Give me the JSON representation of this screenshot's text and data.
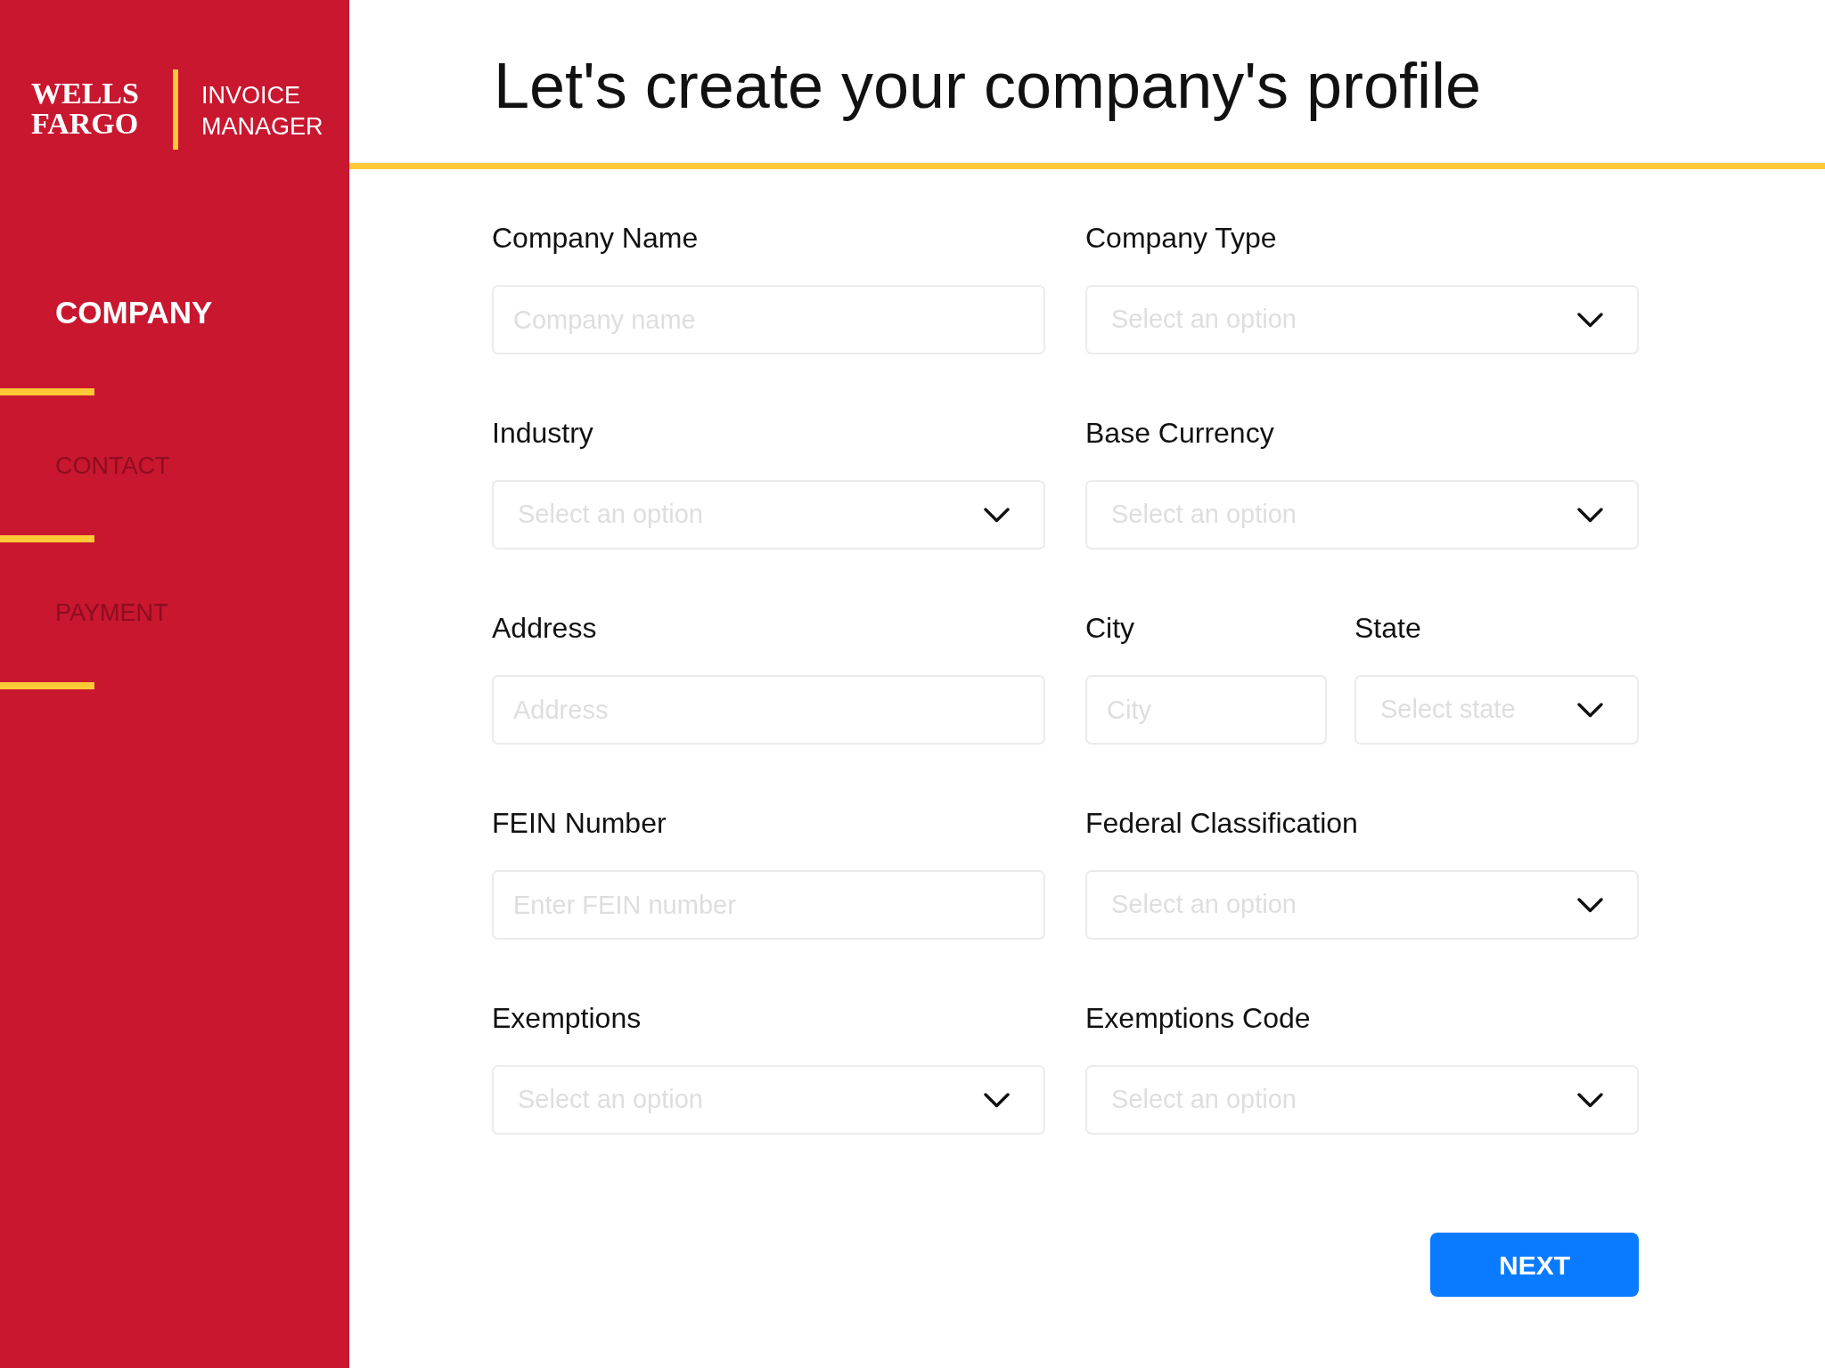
{
  "sidebar": {
    "logo": {
      "brand": "WELLS FARGO",
      "product": "INVOICE MANAGER"
    },
    "steps": [
      {
        "label": "COMPANY",
        "selected": true
      },
      {
        "label": "CONTACT",
        "selected": false
      },
      {
        "label": "PAYMENT",
        "selected": false
      }
    ]
  },
  "page_title": "Let's create your company's profile",
  "form": {
    "rows": [
      [
        {
          "kind": "text",
          "label": "Company Name",
          "placeholder": "Company name"
        },
        {
          "kind": "select",
          "label": "Company Type",
          "placeholder": "Select an option"
        }
      ],
      [
        {
          "kind": "select",
          "label": "Industry",
          "placeholder": "Select an option"
        },
        {
          "kind": "select",
          "label": "Base Currency",
          "placeholder": "Select an option"
        }
      ],
      [
        {
          "kind": "text",
          "label": "Address",
          "placeholder": "Address"
        },
        {
          "kind": "text",
          "label": "City",
          "placeholder": "City"
        },
        {
          "kind": "select",
          "label": "State",
          "placeholder": "Select state"
        }
      ],
      [
        {
          "kind": "text",
          "label": "FEIN Number",
          "placeholder": "Enter FEIN number"
        },
        {
          "kind": "select",
          "label": "Federal Classification",
          "placeholder": "Select an option"
        }
      ],
      [
        {
          "kind": "select",
          "label": "Exemptions",
          "placeholder": "Select an option"
        },
        {
          "kind": "select",
          "label": "Exemptions Code",
          "placeholder": "Select an option"
        }
      ]
    ]
  },
  "buttons": [
    {
      "label": "NEXT"
    }
  ]
}
